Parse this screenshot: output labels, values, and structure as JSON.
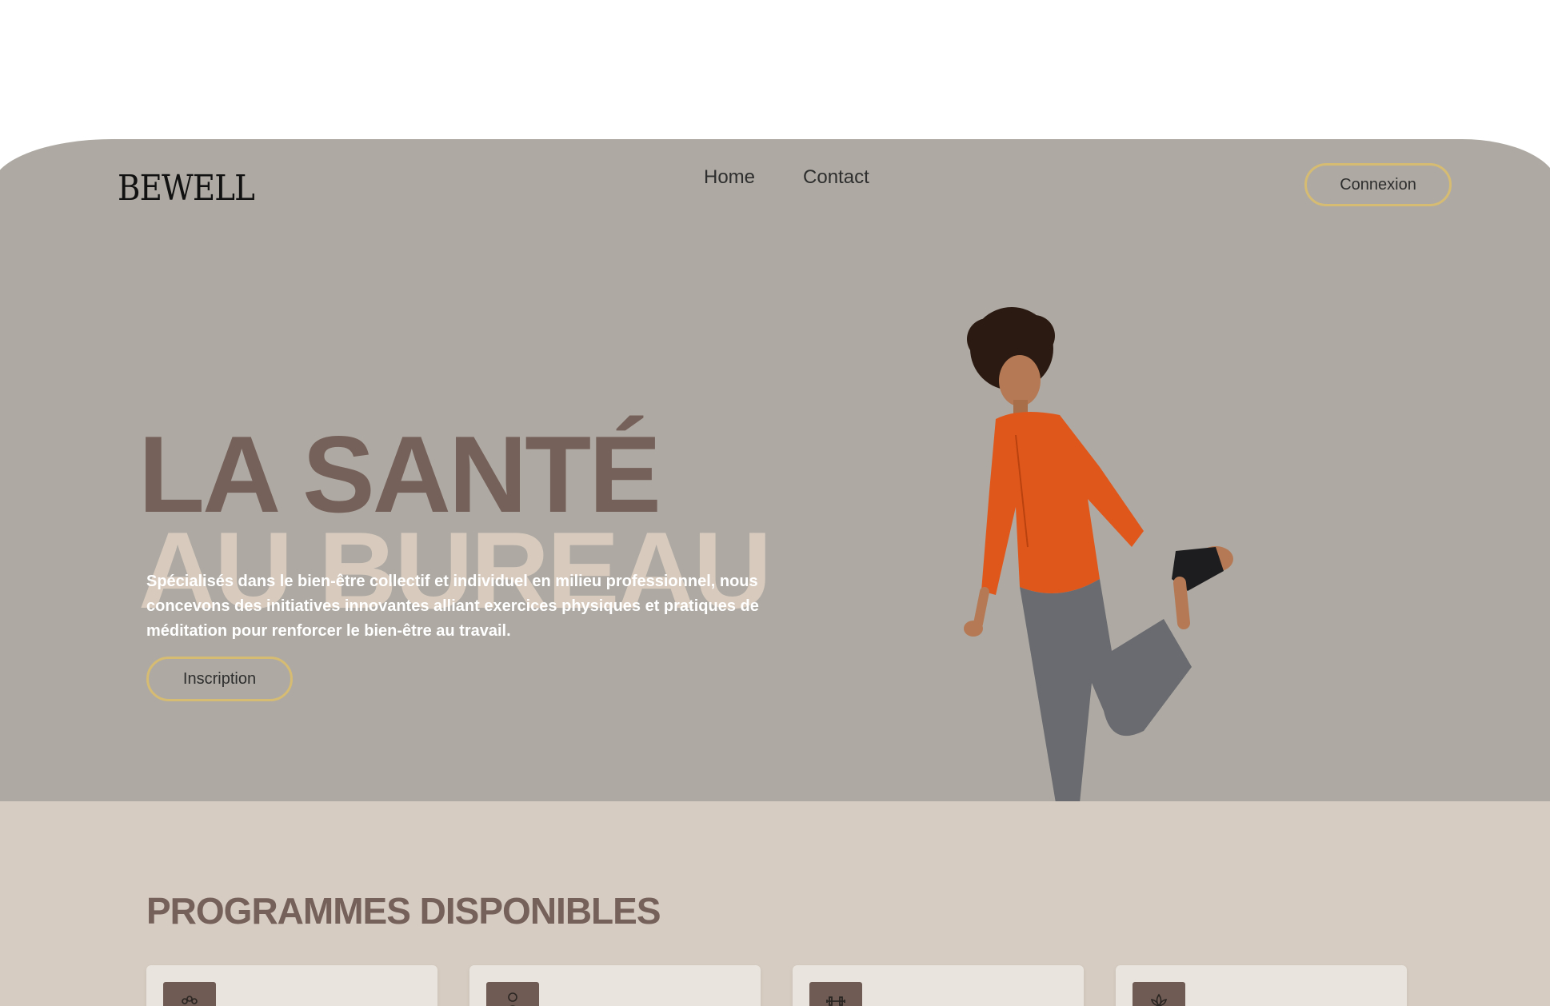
{
  "brand": {
    "logo_text": "BEWELL"
  },
  "nav": {
    "items": [
      "Home",
      "Contact"
    ]
  },
  "header": {
    "login_label": "Connexion"
  },
  "hero": {
    "title_line1": "LA SANTÉ",
    "title_line2": "AU BUREAU",
    "description": "Spécialisés dans le bien-être collectif et individuel en milieu professionnel, nous concevons des initiatives innovantes alliant exercices physiques et pratiques de méditation pour renforcer le bien-être au travail.",
    "cta_label": "Inscription",
    "image_icon": "woman-stretching-photo"
  },
  "programs": {
    "title": "PROGRAMMES DISPONIBLES",
    "cards": [
      {
        "icon": "group-icon"
      },
      {
        "icon": "person-icon"
      },
      {
        "icon": "dumbbell-icon"
      },
      {
        "icon": "lotus-icon"
      }
    ]
  },
  "colors": {
    "hero_bg": "#aeaaa3",
    "accent_brown": "#76615a",
    "accent_beige": "#d8cbbe",
    "button_border": "#d6bb73",
    "programs_bg": "#d6ccc1",
    "card_bg": "#e9e4de",
    "icon_bg": "#6f5b53"
  }
}
